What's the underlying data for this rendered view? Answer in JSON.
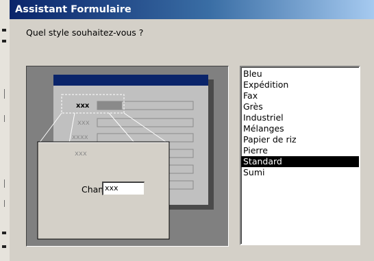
{
  "window": {
    "title": "Assistant Formulaire"
  },
  "prompt": "Quel style souhaitez-vous ?",
  "preview": {
    "labels": [
      "xxx",
      "xxx",
      "xxxx",
      "xxx"
    ],
    "popup_field_label": "Champ",
    "popup_field_value": "xxx"
  },
  "style_list": {
    "items": [
      "Bleu",
      "Expédition",
      "Fax",
      "Grès",
      "Industriel",
      "Mélanges",
      "Papier de riz",
      "Pierre",
      "Standard",
      "Sumi"
    ],
    "selected": "Standard"
  },
  "colors": {
    "title_bar_start": "#0a246a",
    "title_bar_end": "#a6caf0",
    "dialog_bg": "#d4d0c8",
    "selection_bg": "#000000",
    "preview_bg": "#808080",
    "form_header": "#0a246a"
  }
}
